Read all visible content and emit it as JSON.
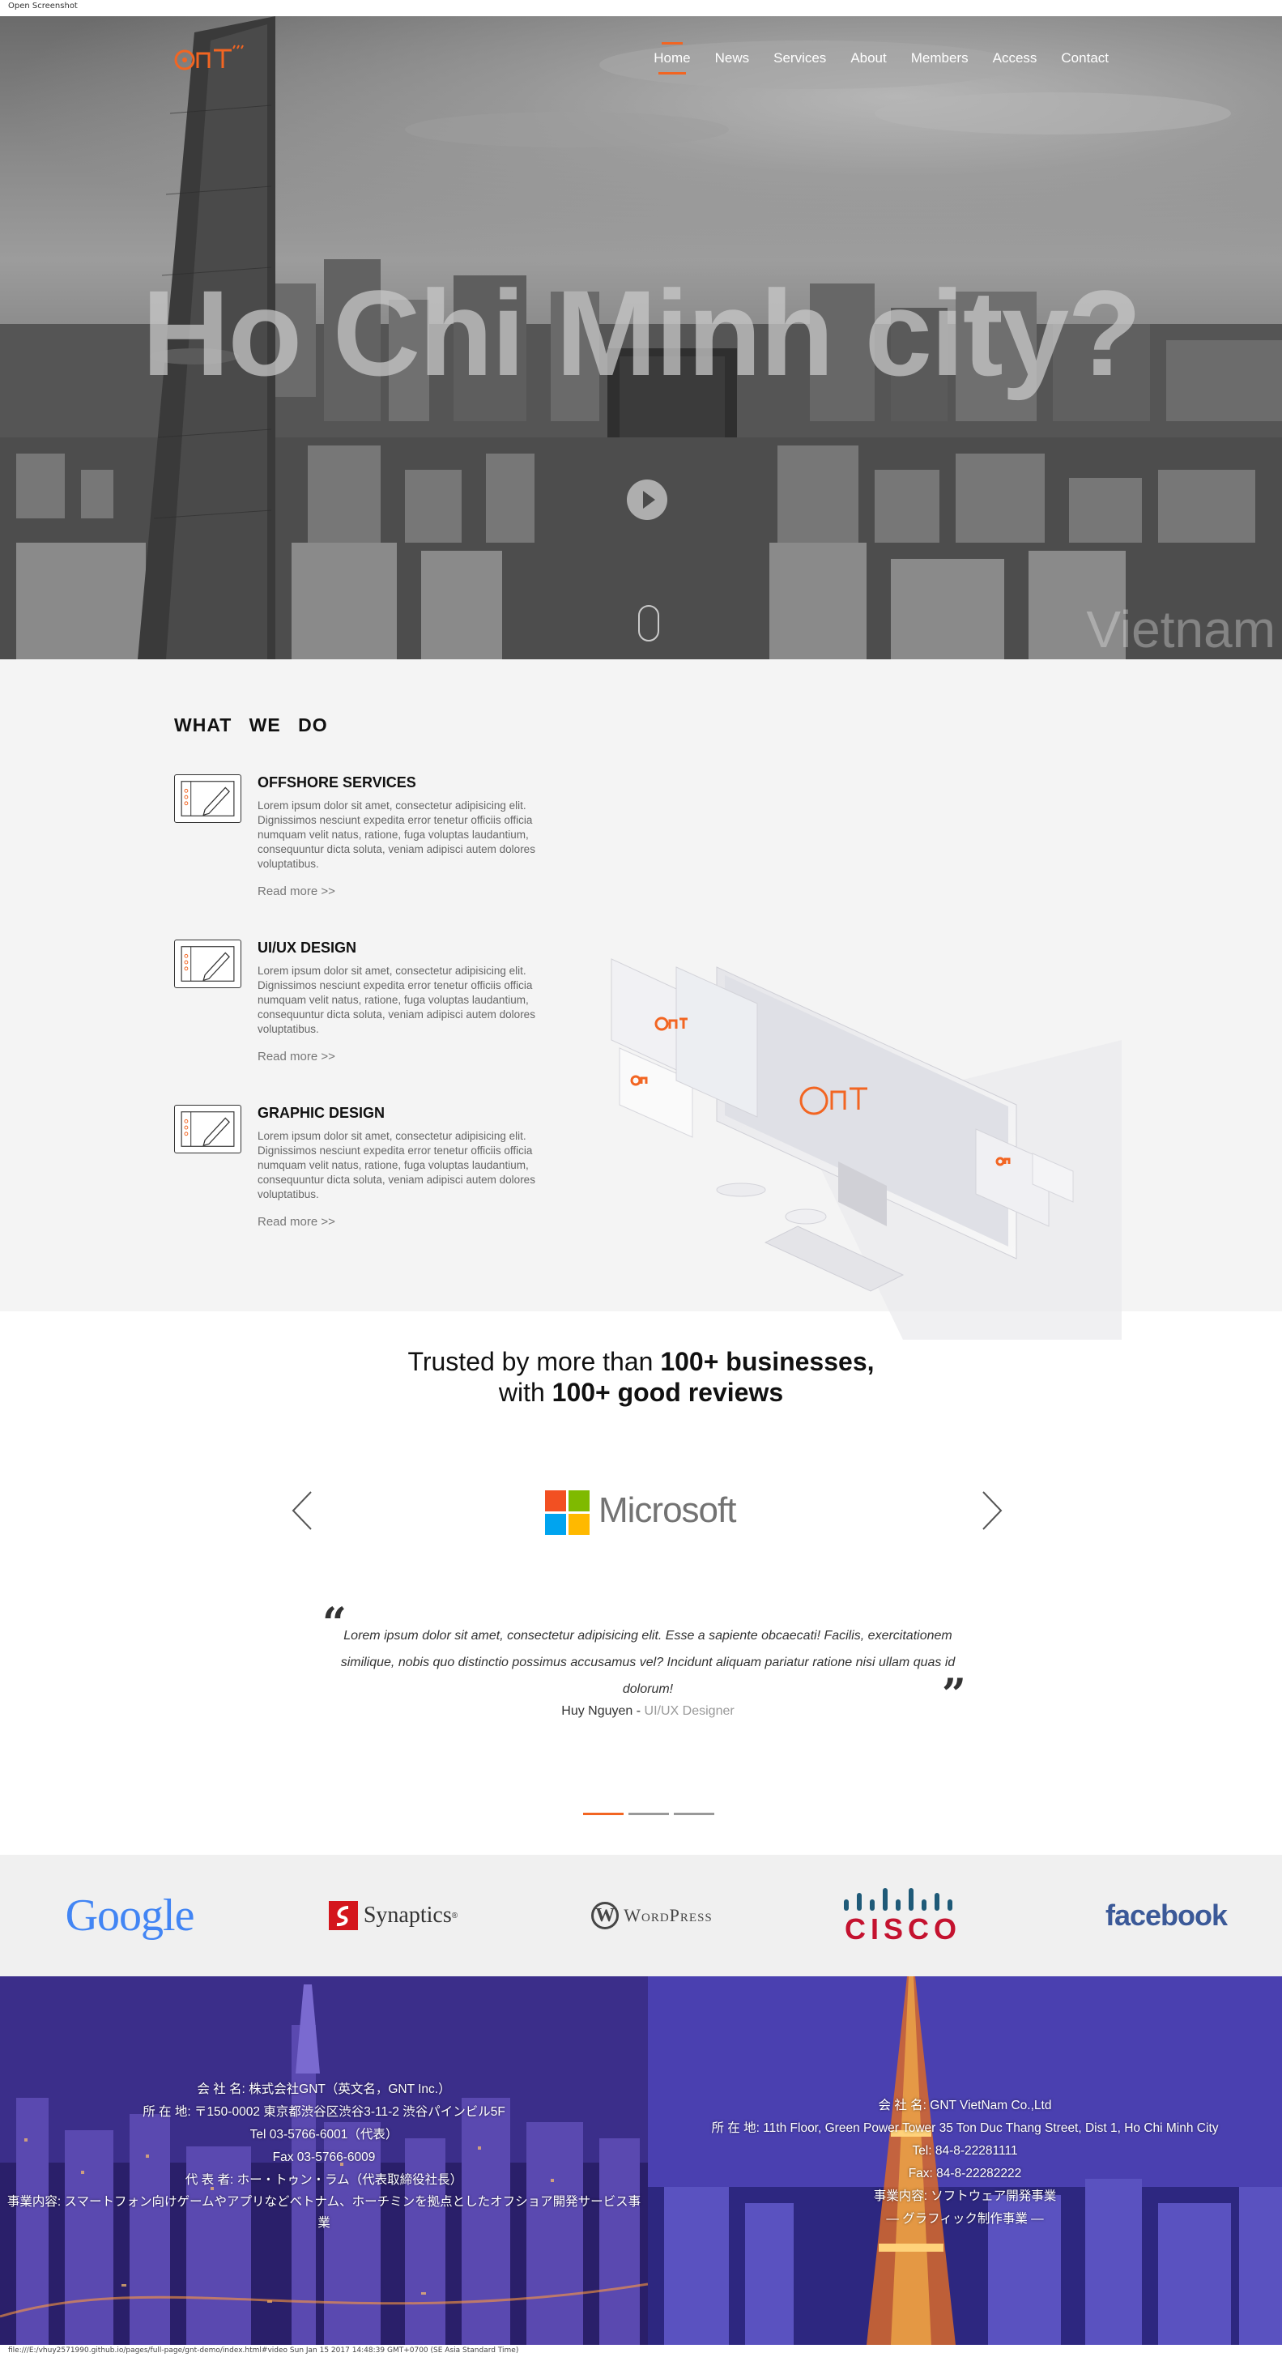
{
  "window": {
    "title": "Open Screenshot"
  },
  "nav": {
    "items": [
      {
        "label": "Home",
        "active": true
      },
      {
        "label": "News"
      },
      {
        "label": "Services"
      },
      {
        "label": "About"
      },
      {
        "label": "Members"
      },
      {
        "label": "Access"
      },
      {
        "label": "Contact"
      }
    ]
  },
  "hero": {
    "title": "Ho Chi Minh city?",
    "subtitle": "Vietnam"
  },
  "what_we_do": {
    "heading": "WHAT WE DO",
    "services": [
      {
        "title": "OFFSHORE SERVICES",
        "body": "Lorem ipsum dolor sit amet, consectetur adipisicing elit. Dignissimos nesciunt expedita error tenetur officiis officia numquam velit natus, ratione, fuga voluptas laudantium, consequuntur dicta soluta, veniam adipisci autem dolores voluptatibus.",
        "link": "Read more >>"
      },
      {
        "title": "UI/UX DESIGN",
        "body": "Lorem ipsum dolor sit amet, consectetur adipisicing elit. Dignissimos nesciunt expedita error tenetur officiis officia numquam velit natus, ratione, fuga voluptas laudantium, consequuntur dicta soluta, veniam adipisci autem dolores voluptatibus.",
        "link": "Read more >>"
      },
      {
        "title": "GRAPHIC DESIGN",
        "body": "Lorem ipsum dolor sit amet, consectetur adipisicing elit. Dignissimos nesciunt expedita error tenetur officiis officia numquam velit natus, ratione, fuga voluptas laudantium, consequuntur dicta soluta, veniam adipisci autem dolores voluptatibus.",
        "link": "Read more >>"
      }
    ]
  },
  "testimonials": {
    "trusted_pre": "Trusted by more than ",
    "trusted_bold1": "100+ businesses,",
    "trusted_mid": "with ",
    "trusted_bold2": "100+ good reviews",
    "client": "Microsoft",
    "quote": "Lorem ipsum dolor sit amet, consectetur adipisicing elit. Esse a sapiente obcaecati! Facilis, exercitationem similique, nobis quo distinctio possimus accusamus vel? Incidunt aliquam pariatur ratione nisi ullam quas id dolorum!",
    "author": "Huy Nguyen",
    "separator": " - ",
    "role": "UI/UX Designer",
    "slide_count": 3,
    "active_slide": 1
  },
  "partners": [
    "Google",
    "Synaptics",
    "WordPress",
    "CISCO",
    "facebook"
  ],
  "partner_sub": {
    "wordpress_w": "W",
    "synaptics_mark": "®"
  },
  "footer": {
    "japan": [
      "会 社 名: 株式会社GNT（英文名，GNT Inc.）",
      "所 在 地: 〒150-0002 東京都渋谷区渋谷3-11-2 渋谷パインビル5F",
      "Tel 03-5766-6001（代表）",
      "Fax 03-5766-6009",
      "代 表 者: ホー・トゥン・ラム（代表取締役社長）",
      "事業内容: スマートフォン向けゲームやアプリなどベトナム、ホーチミンを拠点としたオフショア開発サービス事業"
    ],
    "vietnam": [
      "会 社 名: GNT VietNam Co.,Ltd",
      "所 在 地: 11th Floor, Green Power Tower 35 Ton Duc Thang Street, Dist 1, Ho Chi Minh City",
      "Tel: 84-8-22281111",
      "Fax: 84-8-22282222",
      "事業内容: ソフトウェア開発事業",
      "— グラフィック制作事業 —"
    ]
  },
  "status": {
    "text": "file:///E:/vhuy2571990.github.io/pages/full-page/gnt-demo/index.html#video Sun Jan 15 2017 14:48:39 GMT+0700 (SE Asia Standard Time)"
  },
  "colors": {
    "accent": "#f26522",
    "footer_overlay": "#3a2f8f"
  }
}
